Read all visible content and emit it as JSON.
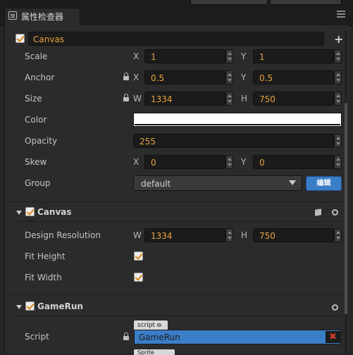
{
  "panel": {
    "tab_title": "属性检查器",
    "node_name": "Canvas",
    "add_icon": "+"
  },
  "node": {
    "scale": {
      "label": "Scale",
      "x_label": "X",
      "x": "1",
      "y_label": "Y",
      "y": "1"
    },
    "anchor": {
      "label": "Anchor",
      "x_label": "X",
      "x": "0.5",
      "y_label": "Y",
      "y": "0.5"
    },
    "size": {
      "label": "Size",
      "w_label": "W",
      "w": "1334",
      "h_label": "H",
      "h": "750"
    },
    "color": {
      "label": "Color",
      "value": "#ffffff"
    },
    "opacity": {
      "label": "Opacity",
      "value": "255"
    },
    "skew": {
      "label": "Skew",
      "x_label": "X",
      "x": "0",
      "y_label": "Y",
      "y": "0"
    },
    "group": {
      "label": "Group",
      "value": "default",
      "edit_button": "编辑"
    }
  },
  "canvas_component": {
    "title": "Canvas",
    "design_resolution": {
      "label": "Design Resolution",
      "w_label": "W",
      "w": "1334",
      "h_label": "H",
      "h": "750"
    },
    "fit_height": {
      "label": "Fit Height",
      "checked": true
    },
    "fit_width": {
      "label": "Fit Width",
      "checked": true
    }
  },
  "gamerun_component": {
    "title": "GameRun",
    "script": {
      "label": "Script",
      "tag": "script",
      "value": "GameRun",
      "remove": "✖"
    },
    "next_tag": "Sprite"
  },
  "colors": {
    "accent": "#3b7ec8",
    "value_text": "#e8a33d",
    "check": "#e08418",
    "remove": "#d0392b"
  }
}
